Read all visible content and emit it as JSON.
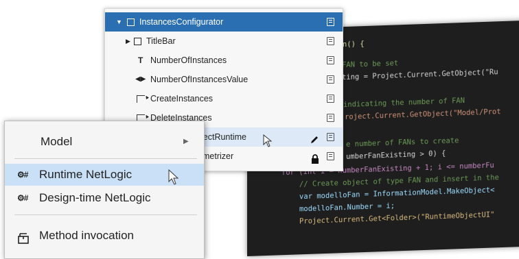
{
  "code_editor": {
    "lines": [
      {
        "indent": "        ",
        "text": "tion() {"
      },
      {
        "indent": "        ",
        "text": "FAN to be set"
      },
      {
        "indent": "        ",
        "text": "ting = Project.Current.GetObject(\"Ru"
      },
      {
        "indent": "",
        "text": ""
      },
      {
        "indent": "        ",
        "text": "indicating the number of FAN"
      },
      {
        "indent": "        ",
        "text": "roject.Current.GetObject(\"Model/Prot"
      },
      {
        "indent": "",
        "text": ""
      },
      {
        "indent": "        ",
        "text": "e number of FANs to create"
      },
      {
        "indent": "        ",
        "text": "umberFanExisting > 0) {"
      },
      {
        "indent": "    ",
        "text": "for (int i = numberFanExisting + 1; i <= numberFu"
      },
      {
        "indent": "        ",
        "text": "// Create object of type FAN and insert in the"
      },
      {
        "indent": "        ",
        "text": "var modelloFan = InformationModel.MakeObject<"
      },
      {
        "indent": "        ",
        "text": "modelloFan.Number = i;"
      },
      {
        "indent": "        ",
        "text": "Project.Current.Get<Folder>(\"RuntimeObjectUI\""
      }
    ]
  },
  "tree": {
    "items": [
      {
        "label": "InstancesConfigurator",
        "icon": "object-box-icon",
        "expander": "expanded"
      },
      {
        "label": "TitleBar",
        "icon": "object-box-icon",
        "expander": "collapsed"
      },
      {
        "label": "NumberOfInstances",
        "icon": "text-t-icon"
      },
      {
        "label": "NumberOfInstancesValue",
        "icon": "arrows-lr-icon"
      },
      {
        "label": "CreateInstances",
        "icon": "click-cursor-icon"
      },
      {
        "label": "DeleteInstances",
        "icon": "click-cursor-icon"
      },
      {
        "label": "jectRuntime",
        "icon": "pencil-icon"
      },
      {
        "label": "metrizer",
        "icon": "lock-icon"
      }
    ]
  },
  "context_menu": {
    "model_label": "Model",
    "runtime_label": "Runtime NetLogic",
    "designtime_label": "Design-time NetLogic",
    "method_label": "Method invocation",
    "netlogic_glyph": "⚙#"
  },
  "colors": {
    "selection_blue": "#2b6fb3",
    "menu_hover": "#c9e0f7",
    "editor_bg": "#1e1e1e"
  }
}
